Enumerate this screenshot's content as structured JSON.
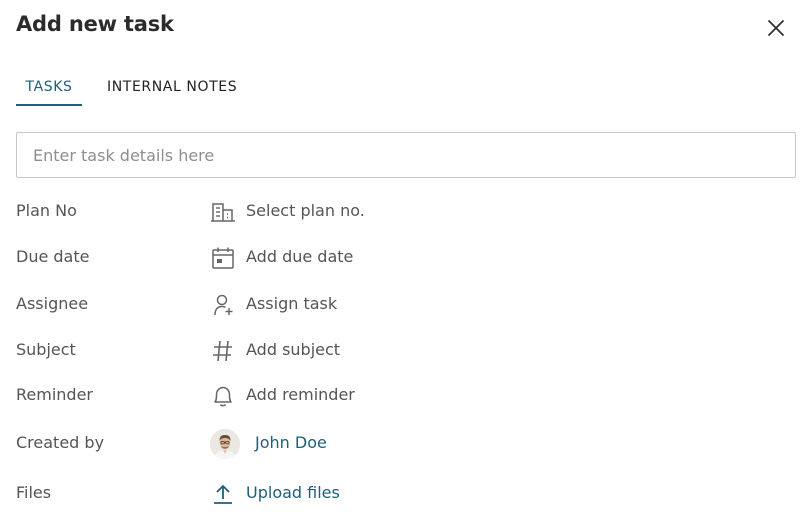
{
  "dialog": {
    "title": "Add new task",
    "close_icon": "close-icon"
  },
  "tabs": [
    {
      "label": "TASKS",
      "active": true
    },
    {
      "label": "INTERNAL NOTES",
      "active": false
    }
  ],
  "task_input": {
    "value": "",
    "placeholder": "Enter task details here"
  },
  "fields": {
    "plan_no": {
      "label": "Plan No",
      "action": "Select plan no.",
      "icon": "building-icon"
    },
    "due_date": {
      "label": "Due date",
      "action": "Add due date",
      "icon": "calendar-icon"
    },
    "assignee": {
      "label": "Assignee",
      "action": "Assign task",
      "icon": "add-user-icon"
    },
    "subject": {
      "label": "Subject",
      "action": "Add subject",
      "icon": "hash-icon"
    },
    "reminder": {
      "label": "Reminder",
      "action": "Add reminder",
      "icon": "bell-icon"
    },
    "created_by": {
      "label": "Created by",
      "value": "John Doe",
      "icon": "avatar"
    },
    "files": {
      "label": "Files",
      "action": "Upload files",
      "icon": "upload-icon"
    }
  },
  "colors": {
    "accent": "#1f5f7a",
    "label": "#555555",
    "border": "#c8c8c8"
  }
}
